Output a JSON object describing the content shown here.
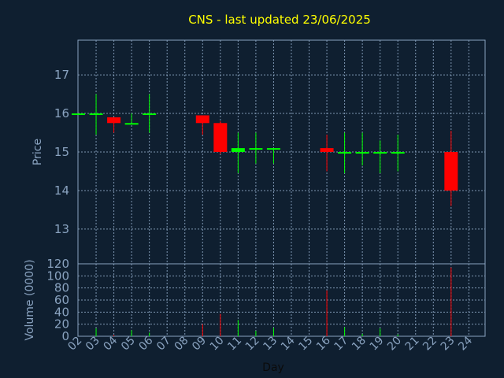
{
  "chart_data": [
    {
      "type": "candlestick",
      "title": "CNS - last updated 23/06/2025",
      "ylabel": "Price",
      "ylim": [
        12.1,
        17.9
      ],
      "yticks": [
        13,
        14,
        15,
        16,
        17
      ],
      "x_categories": [
        "02",
        "03",
        "04",
        "05",
        "06",
        "07",
        "08",
        "09",
        "10",
        "11",
        "12",
        "13",
        "14",
        "15",
        "16",
        "17",
        "18",
        "19",
        "20",
        "21",
        "22",
        "23",
        "24"
      ],
      "grid": true,
      "colors": {
        "up": "#00ff00",
        "down": "#ff0000",
        "neutral": "#00ff00"
      },
      "candles": [
        {
          "day": "02",
          "open": 16.0,
          "high": 16.0,
          "low": 16.0,
          "close": 16.0
        },
        {
          "day": "03",
          "open": 16.0,
          "high": 16.5,
          "low": 15.45,
          "close": 16.0
        },
        {
          "day": "04",
          "open": 15.9,
          "high": 15.9,
          "low": 15.5,
          "close": 15.75
        },
        {
          "day": "05",
          "open": 15.75,
          "high": 16.0,
          "low": 15.75,
          "close": 15.75
        },
        {
          "day": "06",
          "open": 16.0,
          "high": 16.5,
          "low": 15.5,
          "close": 16.0
        },
        {
          "day": "09",
          "open": 15.95,
          "high": 15.95,
          "low": 15.45,
          "close": 15.75
        },
        {
          "day": "10",
          "open": 15.75,
          "high": 15.8,
          "low": 14.95,
          "close": 15.0
        },
        {
          "day": "11",
          "open": 15.0,
          "high": 15.5,
          "low": 14.45,
          "close": 15.1
        },
        {
          "day": "12",
          "open": 15.1,
          "high": 15.5,
          "low": 14.7,
          "close": 15.1
        },
        {
          "day": "13",
          "open": 15.1,
          "high": 15.1,
          "low": 14.7,
          "close": 15.1
        },
        {
          "day": "16",
          "open": 15.1,
          "high": 15.45,
          "low": 14.5,
          "close": 15.0
        },
        {
          "day": "17",
          "open": 15.0,
          "high": 15.5,
          "low": 14.45,
          "close": 15.0
        },
        {
          "day": "18",
          "open": 15.0,
          "high": 15.5,
          "low": 14.65,
          "close": 15.0
        },
        {
          "day": "19",
          "open": 15.0,
          "high": 15.3,
          "low": 14.45,
          "close": 15.0
        },
        {
          "day": "20",
          "open": 15.0,
          "high": 15.45,
          "low": 14.5,
          "close": 15.0
        },
        {
          "day": "23",
          "open": 15.0,
          "high": 15.55,
          "low": 13.6,
          "close": 14.0
        }
      ]
    },
    {
      "type": "bar",
      "ylabel": "Volume (0000)",
      "xlabel": "Day",
      "ylim": [
        0,
        120
      ],
      "yticks": [
        0,
        20,
        40,
        60,
        80,
        100,
        120
      ],
      "grid": true,
      "volumes": [
        {
          "day": "03",
          "value": 13,
          "color": "#00ff00"
        },
        {
          "day": "04",
          "value": 2,
          "color": "#ff0000"
        },
        {
          "day": "05",
          "value": 10,
          "color": "#00ff00"
        },
        {
          "day": "06",
          "value": 6,
          "color": "#00ff00"
        },
        {
          "day": "09",
          "value": 20,
          "color": "#ff0000"
        },
        {
          "day": "10",
          "value": 37,
          "color": "#ff0000"
        },
        {
          "day": "11",
          "value": 27,
          "color": "#00ff00"
        },
        {
          "day": "12",
          "value": 9,
          "color": "#00ff00"
        },
        {
          "day": "13",
          "value": 14,
          "color": "#00ff00"
        },
        {
          "day": "16",
          "value": 76,
          "color": "#ff0000"
        },
        {
          "day": "17",
          "value": 15,
          "color": "#00ff00"
        },
        {
          "day": "18",
          "value": 4,
          "color": "#00ff00"
        },
        {
          "day": "19",
          "value": 13,
          "color": "#00ff00"
        },
        {
          "day": "20",
          "value": 3,
          "color": "#00ff00"
        },
        {
          "day": "23",
          "value": 114,
          "color": "#ff0000"
        }
      ]
    }
  ]
}
